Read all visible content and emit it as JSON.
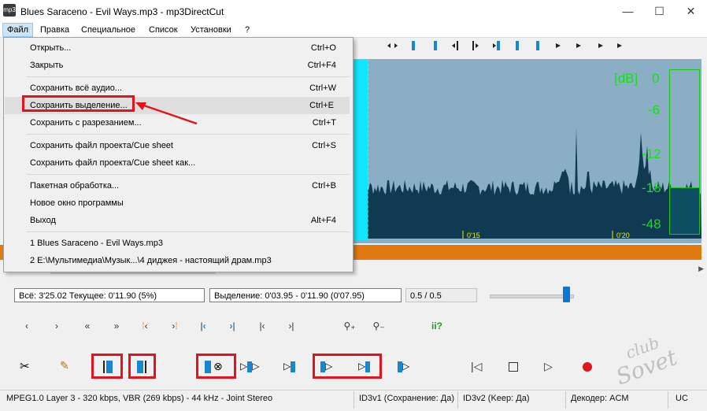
{
  "window": {
    "title": "Blues Saraceno - Evil Ways.mp3 - mp3DirectCut",
    "app_icon_label": "mp3",
    "controls": [
      "—",
      "☐",
      "✕"
    ]
  },
  "menubar": {
    "items": [
      "Файл",
      "Правка",
      "Специальное",
      "Список",
      "Установки",
      "?"
    ]
  },
  "file_menu": {
    "items": [
      {
        "label": "Открыть...",
        "shortcut": "Ctrl+O"
      },
      {
        "label": "Закрыть",
        "shortcut": "Ctrl+F4"
      },
      {
        "label": "Сохранить всё аудио...",
        "shortcut": "Ctrl+W"
      },
      {
        "label": "Сохранить выделение...",
        "shortcut": "Ctrl+E"
      },
      {
        "label": "Сохранить с разрезанием...",
        "shortcut": "Ctrl+T"
      },
      {
        "label": "Сохранить файл проекта/Cue sheet",
        "shortcut": "Ctrl+S"
      },
      {
        "label": "Сохранить файл проекта/Cue sheet как...",
        "shortcut": ""
      },
      {
        "label": "Пакетная обработка...",
        "shortcut": "Ctrl+B"
      },
      {
        "label": "Новое окно программы",
        "shortcut": ""
      },
      {
        "label": "Выход",
        "shortcut": "Alt+F4"
      },
      {
        "label": "1 Blues Saraceno - Evil Ways.mp3",
        "shortcut": ""
      },
      {
        "label": "2 E:\\Мультимедиа\\Музык...\\4 диджея - настоящий драм.mp3",
        "shortcut": ""
      }
    ],
    "highlighted_index": 3
  },
  "waveform": {
    "db_labels": [
      "[dB]",
      "0",
      "-6",
      "-12",
      "-18",
      "-48"
    ],
    "time_markers": [
      "0'15",
      "0'20"
    ],
    "colors": {
      "background": "#8aaec4",
      "wave": "#103a52",
      "selection": "#11e6ff",
      "meter": "#15e015",
      "band": "#e07a10"
    }
  },
  "info": {
    "total": "Всё: 3'25.02   Текущее: 0'11.90   (5%)",
    "selection": "Выделение: 0'03.95 - 0'11.90 (0'07.95)",
    "zoom": "0.5 / 0.5",
    "slider_fraction": 0.9
  },
  "nav_icons": [
    "prev-frame-icon",
    "next-frame-icon",
    "rewind-icon",
    "fast-forward-icon",
    "jump-start-icon",
    "jump-end-icon",
    "to-begin-icon",
    "to-end-icon",
    "set-begin-icon",
    "set-end-icon",
    "zoom-in-icon",
    "zoom-out-icon",
    "normalize-icon"
  ],
  "edit_icons": [
    "cut-icon",
    "pencil-icon",
    "cue-begin-icon",
    "cue-end-icon",
    "play-loop-icon",
    "play-around-icon",
    "play-to-cue-icon",
    "play-from-begin-icon",
    "play-to-end-icon",
    "play-cue-icon",
    "skip-start-icon",
    "stop-icon",
    "play-icon",
    "record-icon"
  ],
  "statusbar": {
    "format": "MPEG1.0 Layer 3 - 320 kbps, VBR (269 kbps) - 44 kHz - Joint Stereo",
    "id3v1": "ID3v1 (Сохранение: Да)",
    "id3v2": "ID3v2 (Keep: Да)",
    "decoder": "Декодер: ACM",
    "uc": "UC"
  },
  "watermark": "club Sovet"
}
